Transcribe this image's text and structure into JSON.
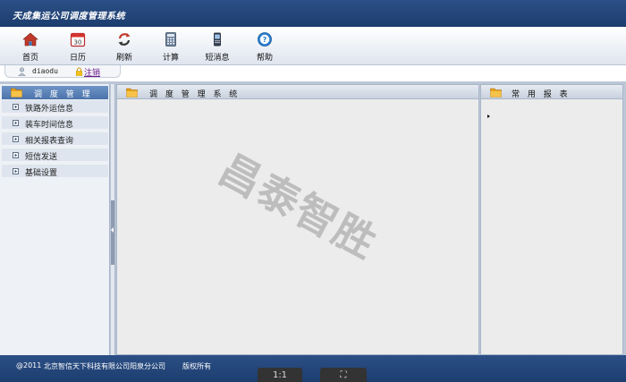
{
  "app": {
    "title": "天成集运公司调度管理系统"
  },
  "toolbar": {
    "items": [
      {
        "label": "首页",
        "icon": "home-icon"
      },
      {
        "label": "日历",
        "icon": "calendar-icon",
        "icon_text": "30"
      },
      {
        "label": "刷新",
        "icon": "refresh-icon"
      },
      {
        "label": "计算",
        "icon": "calculator-icon"
      },
      {
        "label": "短消息",
        "icon": "mobile-phone-icon"
      },
      {
        "label": "帮助",
        "icon": "help-icon",
        "icon_text": "?"
      }
    ]
  },
  "user": {
    "name": "diaodu",
    "logout_label": "注销"
  },
  "sidebar": {
    "title": "调 度 管 理",
    "items": [
      {
        "label": "铁路外运信息"
      },
      {
        "label": "装车时间信息"
      },
      {
        "label": "相关报表查询"
      },
      {
        "label": "短信发送"
      },
      {
        "label": "基础设置"
      }
    ]
  },
  "center_panel": {
    "title": "调 度 管 理 系 统",
    "watermark": "昌泰智胜"
  },
  "right_panel": {
    "title": "常 用 报 表"
  },
  "footer": {
    "copyright": "@2011",
    "company": "北京智信天下科技有限公司阳泉分公司",
    "rights": "版权所有"
  },
  "viewer": {
    "actual_size_label": "1:1",
    "fit_label": "⛶"
  },
  "colors": {
    "header_blue": "#1d3d6e",
    "sidebar_head_blue": "#4b73aa",
    "folder_orange": "#e8a21a",
    "logout_purple": "#6a1a8a"
  }
}
